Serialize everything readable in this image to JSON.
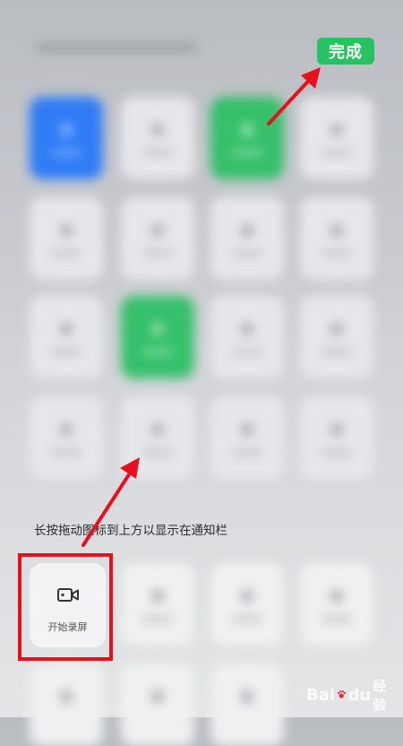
{
  "header": {
    "done_label": "完成"
  },
  "hint": {
    "text": "长按拖动图标到上方以显示在通知栏"
  },
  "available_tiles": [
    {
      "label": "开始录屏",
      "icon": "video-camera-icon"
    }
  ],
  "watermark": {
    "brand": "Bai",
    "brand_end": "du",
    "sub": "经验"
  },
  "colors": {
    "accent_green": "#29c262",
    "highlight_red": "#e8101c",
    "tile_blue": "#2f7cf6"
  }
}
